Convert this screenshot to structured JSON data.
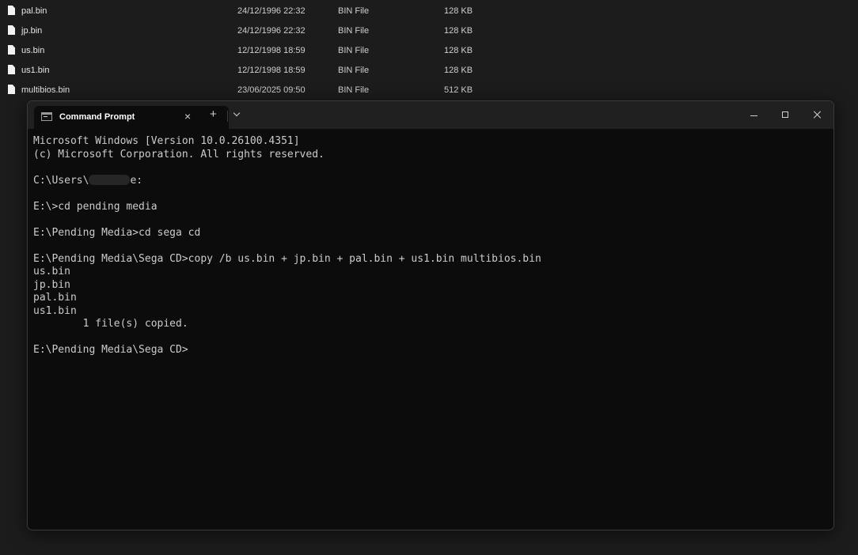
{
  "explorer": {
    "files": [
      {
        "name": "pal.bin",
        "date": "24/12/1996 22:32",
        "type": "BIN File",
        "size": "128 KB"
      },
      {
        "name": "jp.bin",
        "date": "24/12/1996 22:32",
        "type": "BIN File",
        "size": "128 KB"
      },
      {
        "name": "us.bin",
        "date": "12/12/1998 18:59",
        "type": "BIN File",
        "size": "128 KB"
      },
      {
        "name": "us1.bin",
        "date": "12/12/1998 18:59",
        "type": "BIN File",
        "size": "128 KB"
      },
      {
        "name": "multibios.bin",
        "date": "23/06/2025 09:50",
        "type": "BIN File",
        "size": "512 KB"
      }
    ]
  },
  "terminal": {
    "tab_title": "Command Prompt",
    "tab_close": "×",
    "new_tab": "+",
    "lines": [
      "Microsoft Windows [Version 10.0.26100.4351]",
      "(c) Microsoft Corporation. All rights reserved.",
      "",
      "",
      "",
      "E:\\>cd pending media",
      "",
      "E:\\Pending Media>cd sega cd",
      "",
      "E:\\Pending Media\\Sega CD>copy /b us.bin + jp.bin + pal.bin + us1.bin multibios.bin",
      "us.bin",
      "jp.bin",
      "pal.bin",
      "us1.bin",
      "        1 file(s) copied.",
      "",
      "E:\\Pending Media\\Sega CD>"
    ],
    "redacted_prompt": {
      "before": "C:\\Users\\",
      "after": "e:"
    }
  },
  "colors": {
    "background": "#1c1c1c",
    "terminal_bg": "#0c0c0c",
    "titlebar": "#202020",
    "text": "#cccccc"
  }
}
